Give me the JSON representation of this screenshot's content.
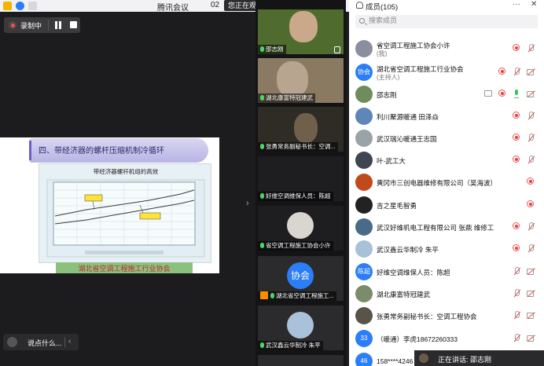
{
  "window": {
    "title": "腾讯会议",
    "time_partial": "02",
    "watching_banner": "您正在观看邵志刚的屏幕",
    "watching_menu_glyph": "☰"
  },
  "recording": {
    "label": "录制中"
  },
  "slide": {
    "title": "四、带经济器的螺杆压缩机制冷循环",
    "chart_title": "带经济器螺杆机组的高效",
    "footer": "湖北省空调工程施工行业协会"
  },
  "chat": {
    "placeholder": "说点什么...",
    "chevron": "‹"
  },
  "stage_collapse_glyph": "›",
  "video_tiles": [
    {
      "name": "邵志刚",
      "mic": "on",
      "bg": "#6c7a4a"
    },
    {
      "name": "湖北康富特冠建武",
      "mic": "on",
      "bg": "#8a7d6a"
    },
    {
      "name": "张勇常务副秘书长：空调...",
      "mic": "on",
      "bg": "#3a3a32"
    },
    {
      "name": "好维空调维保人员：陈超",
      "mic": "on",
      "bg": "#1e1e20"
    },
    {
      "name": "省空调工程施工协会小许",
      "mic": "on",
      "bg": "#1e1e20"
    },
    {
      "name": "湖北省空调工程施工...",
      "mic": "on",
      "avatar_text": "协会",
      "bg": "#2b2b2d"
    },
    {
      "name": "武汉鑫云华制冷 朱平",
      "mic": "on",
      "bg": "#2b2b2d"
    }
  ],
  "members": {
    "title": "成员(105)",
    "more_glyph": "···",
    "close_glyph": "✕",
    "search_placeholder": "搜索成员",
    "list": [
      {
        "name": "省空调工程施工协会小许",
        "sub": "(我)",
        "avatar": "#8a8fa0"
      },
      {
        "name": "湖北省空调工程施工行业协会",
        "sub": "(主持人)",
        "avatar_text": "协会"
      },
      {
        "name": "邵志刚",
        "avatar": "#6e8c5c"
      },
      {
        "name": "利川聚源暖通 田泽焱",
        "avatar": "#5f86b8"
      },
      {
        "name": "武汉瑞沁暖通王志国",
        "avatar": "#9aa3a8"
      },
      {
        "name": "叶-武工大",
        "avatar": "#3e4652"
      },
      {
        "name": "黄冈市三创电器维修有限公司（吴海波）",
        "avatar": "#c04a1c"
      },
      {
        "name": "吉之星毛智勇",
        "avatar": "#222222"
      },
      {
        "name": "武汉好维机电工程有限公司 张鼎 维修工",
        "avatar": "#4a6a8a"
      },
      {
        "name": "武汉鑫云华制冷 朱平",
        "avatar": "#a8c0d8"
      },
      {
        "name": "好维空调维保人员：陈超",
        "avatar_text": "陈超"
      },
      {
        "name": "湖北康富特冠建武",
        "avatar": "#7a8c6a"
      },
      {
        "name": "张勇常务副秘书长：空调工程协会",
        "avatar": "#5a5448"
      },
      {
        "name": "（暖通）李虎18672260333",
        "avatar_text": "33"
      },
      {
        "name": "158****4246",
        "avatar_text": "46"
      }
    ]
  },
  "speaking": {
    "text": "正在讲话: 邵志刚"
  }
}
